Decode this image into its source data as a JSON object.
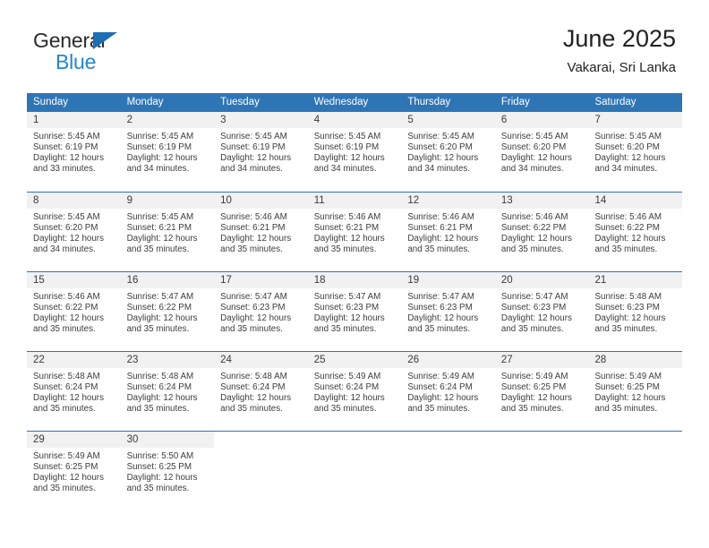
{
  "brand": {
    "name_top": "General",
    "name_bottom": "Blue",
    "triangle_color": "#1b6fb5",
    "bottom_color": "#2286d4"
  },
  "header": {
    "title": "June 2025",
    "subtitle": "Vakarai, Sri Lanka"
  },
  "theme": {
    "header_blue": "#2e75b6",
    "day_band_gray": "#f1f1f1",
    "text_color": "#3d3d3d"
  },
  "weekdays": [
    "Sunday",
    "Monday",
    "Tuesday",
    "Wednesday",
    "Thursday",
    "Friday",
    "Saturday"
  ],
  "weeks": [
    [
      {
        "day": "1",
        "sunrise": "Sunrise: 5:45 AM",
        "sunset": "Sunset: 6:19 PM",
        "daylight_line1": "Daylight: 12 hours",
        "daylight_line2": "and 33 minutes."
      },
      {
        "day": "2",
        "sunrise": "Sunrise: 5:45 AM",
        "sunset": "Sunset: 6:19 PM",
        "daylight_line1": "Daylight: 12 hours",
        "daylight_line2": "and 34 minutes."
      },
      {
        "day": "3",
        "sunrise": "Sunrise: 5:45 AM",
        "sunset": "Sunset: 6:19 PM",
        "daylight_line1": "Daylight: 12 hours",
        "daylight_line2": "and 34 minutes."
      },
      {
        "day": "4",
        "sunrise": "Sunrise: 5:45 AM",
        "sunset": "Sunset: 6:19 PM",
        "daylight_line1": "Daylight: 12 hours",
        "daylight_line2": "and 34 minutes."
      },
      {
        "day": "5",
        "sunrise": "Sunrise: 5:45 AM",
        "sunset": "Sunset: 6:20 PM",
        "daylight_line1": "Daylight: 12 hours",
        "daylight_line2": "and 34 minutes."
      },
      {
        "day": "6",
        "sunrise": "Sunrise: 5:45 AM",
        "sunset": "Sunset: 6:20 PM",
        "daylight_line1": "Daylight: 12 hours",
        "daylight_line2": "and 34 minutes."
      },
      {
        "day": "7",
        "sunrise": "Sunrise: 5:45 AM",
        "sunset": "Sunset: 6:20 PM",
        "daylight_line1": "Daylight: 12 hours",
        "daylight_line2": "and 34 minutes."
      }
    ],
    [
      {
        "day": "8",
        "sunrise": "Sunrise: 5:45 AM",
        "sunset": "Sunset: 6:20 PM",
        "daylight_line1": "Daylight: 12 hours",
        "daylight_line2": "and 34 minutes."
      },
      {
        "day": "9",
        "sunrise": "Sunrise: 5:45 AM",
        "sunset": "Sunset: 6:21 PM",
        "daylight_line1": "Daylight: 12 hours",
        "daylight_line2": "and 35 minutes."
      },
      {
        "day": "10",
        "sunrise": "Sunrise: 5:46 AM",
        "sunset": "Sunset: 6:21 PM",
        "daylight_line1": "Daylight: 12 hours",
        "daylight_line2": "and 35 minutes."
      },
      {
        "day": "11",
        "sunrise": "Sunrise: 5:46 AM",
        "sunset": "Sunset: 6:21 PM",
        "daylight_line1": "Daylight: 12 hours",
        "daylight_line2": "and 35 minutes."
      },
      {
        "day": "12",
        "sunrise": "Sunrise: 5:46 AM",
        "sunset": "Sunset: 6:21 PM",
        "daylight_line1": "Daylight: 12 hours",
        "daylight_line2": "and 35 minutes."
      },
      {
        "day": "13",
        "sunrise": "Sunrise: 5:46 AM",
        "sunset": "Sunset: 6:22 PM",
        "daylight_line1": "Daylight: 12 hours",
        "daylight_line2": "and 35 minutes."
      },
      {
        "day": "14",
        "sunrise": "Sunrise: 5:46 AM",
        "sunset": "Sunset: 6:22 PM",
        "daylight_line1": "Daylight: 12 hours",
        "daylight_line2": "and 35 minutes."
      }
    ],
    [
      {
        "day": "15",
        "sunrise": "Sunrise: 5:46 AM",
        "sunset": "Sunset: 6:22 PM",
        "daylight_line1": "Daylight: 12 hours",
        "daylight_line2": "and 35 minutes."
      },
      {
        "day": "16",
        "sunrise": "Sunrise: 5:47 AM",
        "sunset": "Sunset: 6:22 PM",
        "daylight_line1": "Daylight: 12 hours",
        "daylight_line2": "and 35 minutes."
      },
      {
        "day": "17",
        "sunrise": "Sunrise: 5:47 AM",
        "sunset": "Sunset: 6:23 PM",
        "daylight_line1": "Daylight: 12 hours",
        "daylight_line2": "and 35 minutes."
      },
      {
        "day": "18",
        "sunrise": "Sunrise: 5:47 AM",
        "sunset": "Sunset: 6:23 PM",
        "daylight_line1": "Daylight: 12 hours",
        "daylight_line2": "and 35 minutes."
      },
      {
        "day": "19",
        "sunrise": "Sunrise: 5:47 AM",
        "sunset": "Sunset: 6:23 PM",
        "daylight_line1": "Daylight: 12 hours",
        "daylight_line2": "and 35 minutes."
      },
      {
        "day": "20",
        "sunrise": "Sunrise: 5:47 AM",
        "sunset": "Sunset: 6:23 PM",
        "daylight_line1": "Daylight: 12 hours",
        "daylight_line2": "and 35 minutes."
      },
      {
        "day": "21",
        "sunrise": "Sunrise: 5:48 AM",
        "sunset": "Sunset: 6:23 PM",
        "daylight_line1": "Daylight: 12 hours",
        "daylight_line2": "and 35 minutes."
      }
    ],
    [
      {
        "day": "22",
        "sunrise": "Sunrise: 5:48 AM",
        "sunset": "Sunset: 6:24 PM",
        "daylight_line1": "Daylight: 12 hours",
        "daylight_line2": "and 35 minutes."
      },
      {
        "day": "23",
        "sunrise": "Sunrise: 5:48 AM",
        "sunset": "Sunset: 6:24 PM",
        "daylight_line1": "Daylight: 12 hours",
        "daylight_line2": "and 35 minutes."
      },
      {
        "day": "24",
        "sunrise": "Sunrise: 5:48 AM",
        "sunset": "Sunset: 6:24 PM",
        "daylight_line1": "Daylight: 12 hours",
        "daylight_line2": "and 35 minutes."
      },
      {
        "day": "25",
        "sunrise": "Sunrise: 5:49 AM",
        "sunset": "Sunset: 6:24 PM",
        "daylight_line1": "Daylight: 12 hours",
        "daylight_line2": "and 35 minutes."
      },
      {
        "day": "26",
        "sunrise": "Sunrise: 5:49 AM",
        "sunset": "Sunset: 6:24 PM",
        "daylight_line1": "Daylight: 12 hours",
        "daylight_line2": "and 35 minutes."
      },
      {
        "day": "27",
        "sunrise": "Sunrise: 5:49 AM",
        "sunset": "Sunset: 6:25 PM",
        "daylight_line1": "Daylight: 12 hours",
        "daylight_line2": "and 35 minutes."
      },
      {
        "day": "28",
        "sunrise": "Sunrise: 5:49 AM",
        "sunset": "Sunset: 6:25 PM",
        "daylight_line1": "Daylight: 12 hours",
        "daylight_line2": "and 35 minutes."
      }
    ],
    [
      {
        "day": "29",
        "sunrise": "Sunrise: 5:49 AM",
        "sunset": "Sunset: 6:25 PM",
        "daylight_line1": "Daylight: 12 hours",
        "daylight_line2": "and 35 minutes."
      },
      {
        "day": "30",
        "sunrise": "Sunrise: 5:50 AM",
        "sunset": "Sunset: 6:25 PM",
        "daylight_line1": "Daylight: 12 hours",
        "daylight_line2": "and 35 minutes."
      },
      {
        "day": "",
        "sunrise": "",
        "sunset": "",
        "daylight_line1": "",
        "daylight_line2": ""
      },
      {
        "day": "",
        "sunrise": "",
        "sunset": "",
        "daylight_line1": "",
        "daylight_line2": ""
      },
      {
        "day": "",
        "sunrise": "",
        "sunset": "",
        "daylight_line1": "",
        "daylight_line2": ""
      },
      {
        "day": "",
        "sunrise": "",
        "sunset": "",
        "daylight_line1": "",
        "daylight_line2": ""
      },
      {
        "day": "",
        "sunrise": "",
        "sunset": "",
        "daylight_line1": "",
        "daylight_line2": ""
      }
    ]
  ]
}
